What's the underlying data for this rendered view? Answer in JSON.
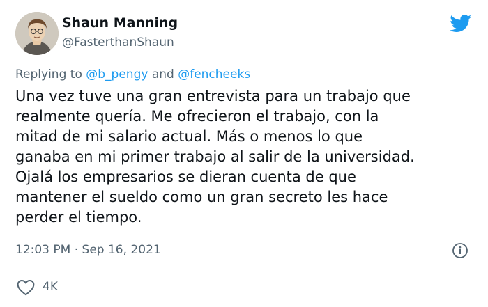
{
  "author": {
    "name": "Shaun Manning",
    "handle": "@FasterthanShaun"
  },
  "reply": {
    "prefix": "Replying to",
    "user1": "@b_pengy",
    "conjunction": "and",
    "user2": "@fencheeks"
  },
  "tweet": {
    "lines": [
      "Una vez tuve una gran entrevista para un trabajo que",
      "realmente quería. Me ofrecieron el trabajo, con la",
      "mitad de mi salario actual. Más o menos lo que",
      "ganaba en mi primer trabajo al salir de la universidad.",
      "Ojalá los empresarios se dieran cuenta de que",
      "mantener el sueldo como un gran secreto les hace",
      "perder el tiempo."
    ]
  },
  "meta": {
    "time": "12:03 PM",
    "separator": "·",
    "date": "Sep 16, 2021"
  },
  "actions": {
    "likes": "4K"
  },
  "icons": {
    "brand": "twitter-bird-icon",
    "info": "info-icon",
    "like": "heart-icon"
  },
  "colors": {
    "brand": "#1d9bf0",
    "text": "#0f1419",
    "secondary": "#536471",
    "divider": "#cfd9de"
  }
}
